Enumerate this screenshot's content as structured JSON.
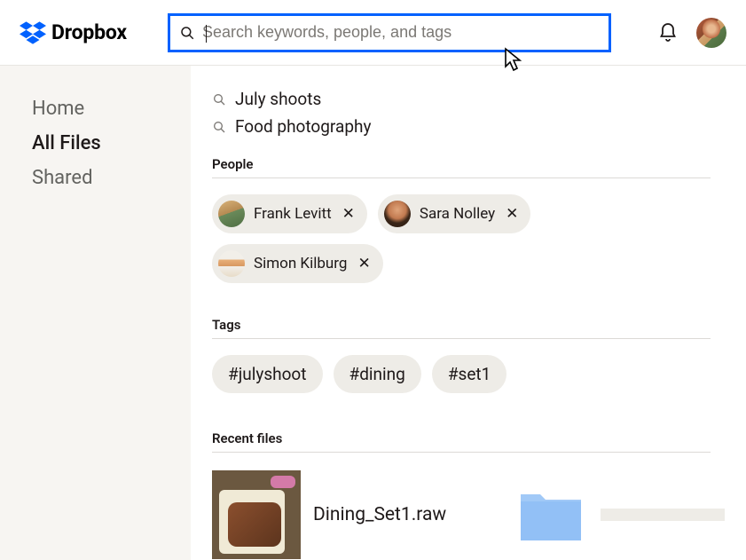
{
  "brand": "Dropbox",
  "search": {
    "placeholder": "Search keywords, people, and tags",
    "value": ""
  },
  "sidebar": {
    "items": [
      "Home",
      "All Files",
      "Shared"
    ],
    "active_index": 1
  },
  "suggestions": [
    "July shoots",
    "Food photography"
  ],
  "sections": {
    "people": "People",
    "tags": "Tags",
    "recent": "Recent files"
  },
  "people": [
    {
      "name": "Frank Levitt"
    },
    {
      "name": "Sara Nolley"
    },
    {
      "name": "Simon Kilburg"
    }
  ],
  "tags": [
    "#julyshoot",
    "#dining",
    "#set1"
  ],
  "recent_files": [
    {
      "name": "Dining_Set1.raw"
    }
  ]
}
